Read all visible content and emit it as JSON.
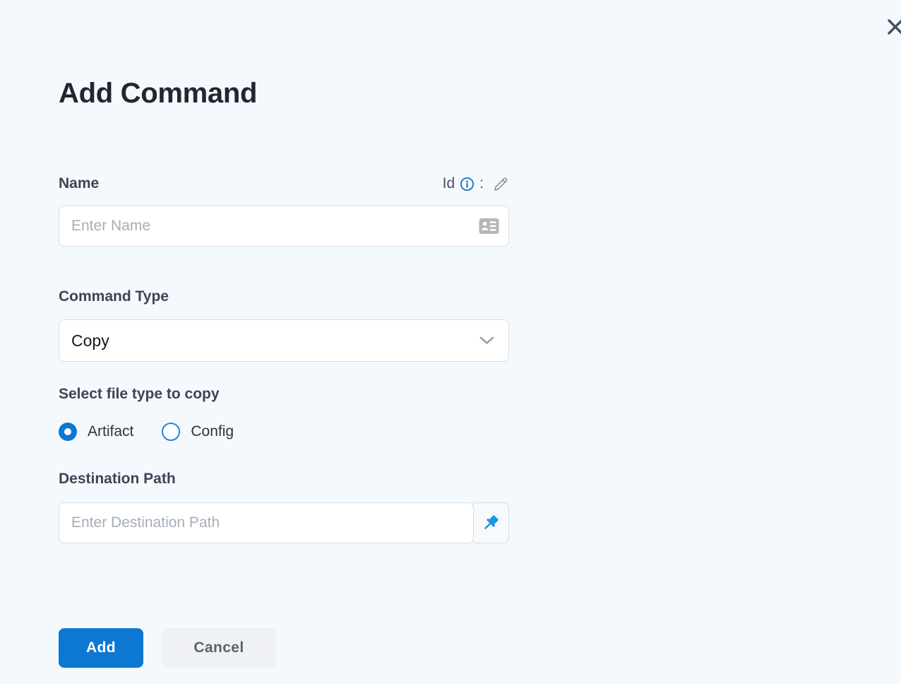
{
  "modal": {
    "title": "Add Command"
  },
  "form": {
    "name": {
      "label": "Name",
      "id_meta": {
        "label": "Id",
        "separator": ":"
      },
      "input": {
        "placeholder": "Enter Name",
        "value": ""
      }
    },
    "command_type": {
      "label": "Command Type",
      "selected_value": "Copy"
    },
    "file_type": {
      "label": "Select file type to copy",
      "options": [
        {
          "label": "Artifact",
          "selected": true
        },
        {
          "label": "Config",
          "selected": false
        }
      ]
    },
    "destination_path": {
      "label": "Destination Path",
      "input": {
        "placeholder": "Enter Destination Path",
        "value": ""
      }
    }
  },
  "actions": {
    "add": "Add",
    "cancel": "Cancel"
  },
  "icons": {
    "close": "close-icon",
    "info": "info-circle-icon",
    "edit": "edit-pencil-icon",
    "id_card": "id-card-icon",
    "chevron": "chevron-down-icon",
    "pushpin": "pushpin-icon"
  },
  "colors": {
    "background": "#f4f9fd",
    "primary_blue": "#0d78d2",
    "pin_blue": "#1a97e0",
    "info_blue": "#1677cc",
    "input_border": "#dadbe4",
    "label_text": "#3e4455",
    "title_text": "#212631",
    "placeholder_text": "#a6aeb8",
    "cancel_bg": "#f0f1f4",
    "cancel_text": "#5c6170"
  }
}
